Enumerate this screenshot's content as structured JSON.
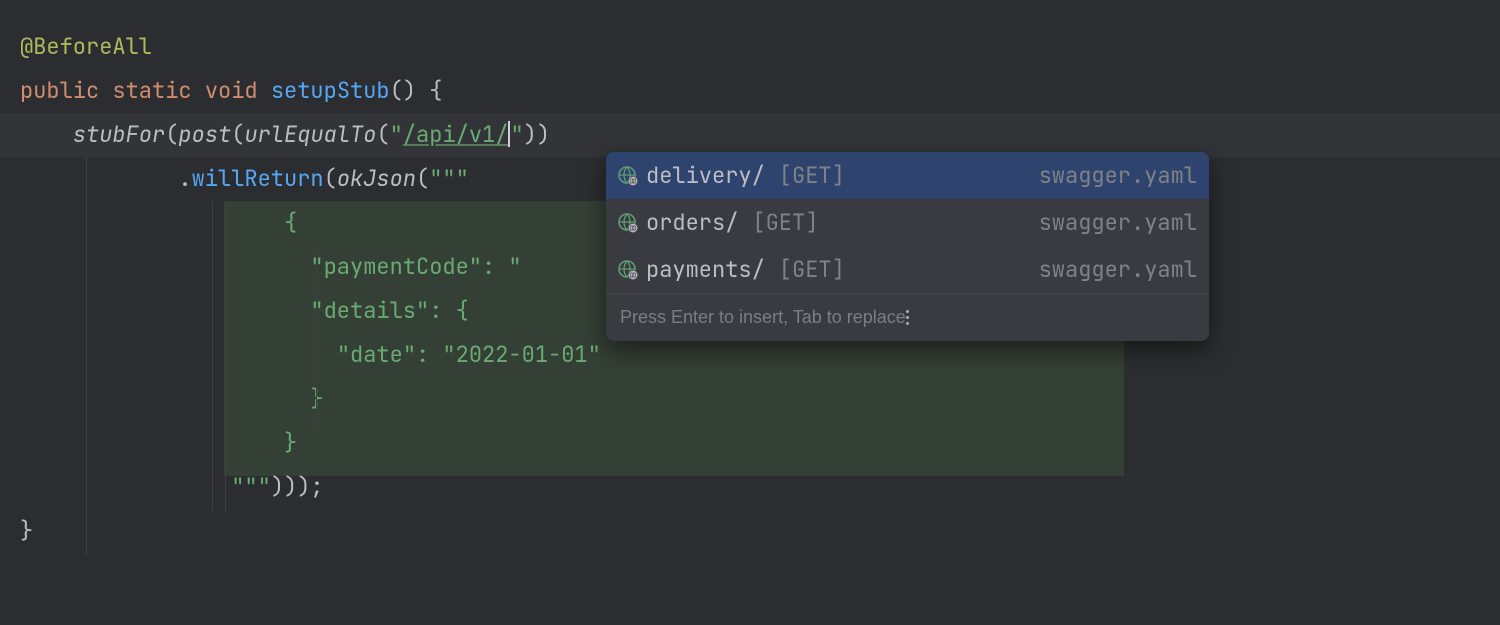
{
  "code": {
    "annotation": "@BeforeAll",
    "kw_public": "public",
    "kw_static": "static",
    "kw_void": "void",
    "method_name": "setupStub",
    "stub_for": "stubFor",
    "post": "post",
    "url_equal_to": "urlEqualTo",
    "url_value": "/api/v1/",
    "will_return": "willReturn",
    "ok_json": "okJson",
    "json_key1": "\"paymentCode\"",
    "json_val1_partial": ": \"",
    "json_key2": "\"details\"",
    "json_key3": "\"date\"",
    "json_val3": "\"2022-01-01\""
  },
  "popup": {
    "items": [
      {
        "label": "delivery/",
        "method": "[GET]",
        "source": "swagger.yaml",
        "selected": true
      },
      {
        "label": "orders/",
        "method": "[GET]",
        "source": "swagger.yaml",
        "selected": false
      },
      {
        "label": "payments/",
        "method": "[GET]",
        "source": "swagger.yaml",
        "selected": false
      }
    ],
    "footer": "Press Enter to insert, Tab to replace"
  }
}
